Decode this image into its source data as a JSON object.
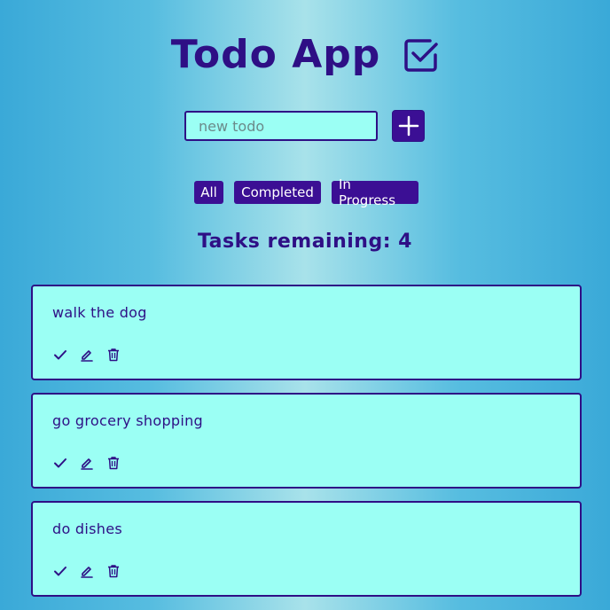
{
  "header": {
    "title": "Todo App",
    "icon": "checkbox-icon"
  },
  "new_todo": {
    "value": "",
    "placeholder": "new todo",
    "add_icon": "plus-icon"
  },
  "filters": [
    {
      "label": "All"
    },
    {
      "label": "Completed"
    },
    {
      "label": "In Progress"
    }
  ],
  "remaining_text": "Tasks remaining: 4",
  "todos": [
    {
      "text": "walk the dog"
    },
    {
      "text": "go grocery shopping"
    },
    {
      "text": "do dishes"
    }
  ],
  "actions": [
    "check-icon",
    "edit-icon",
    "trash-icon"
  ],
  "colors": {
    "accent": "#3b0f94",
    "text": "#2e0f85",
    "card_bg": "#9bfff4",
    "bg_edge": "#3aa9d8",
    "bg_center": "#a8e2ea"
  }
}
